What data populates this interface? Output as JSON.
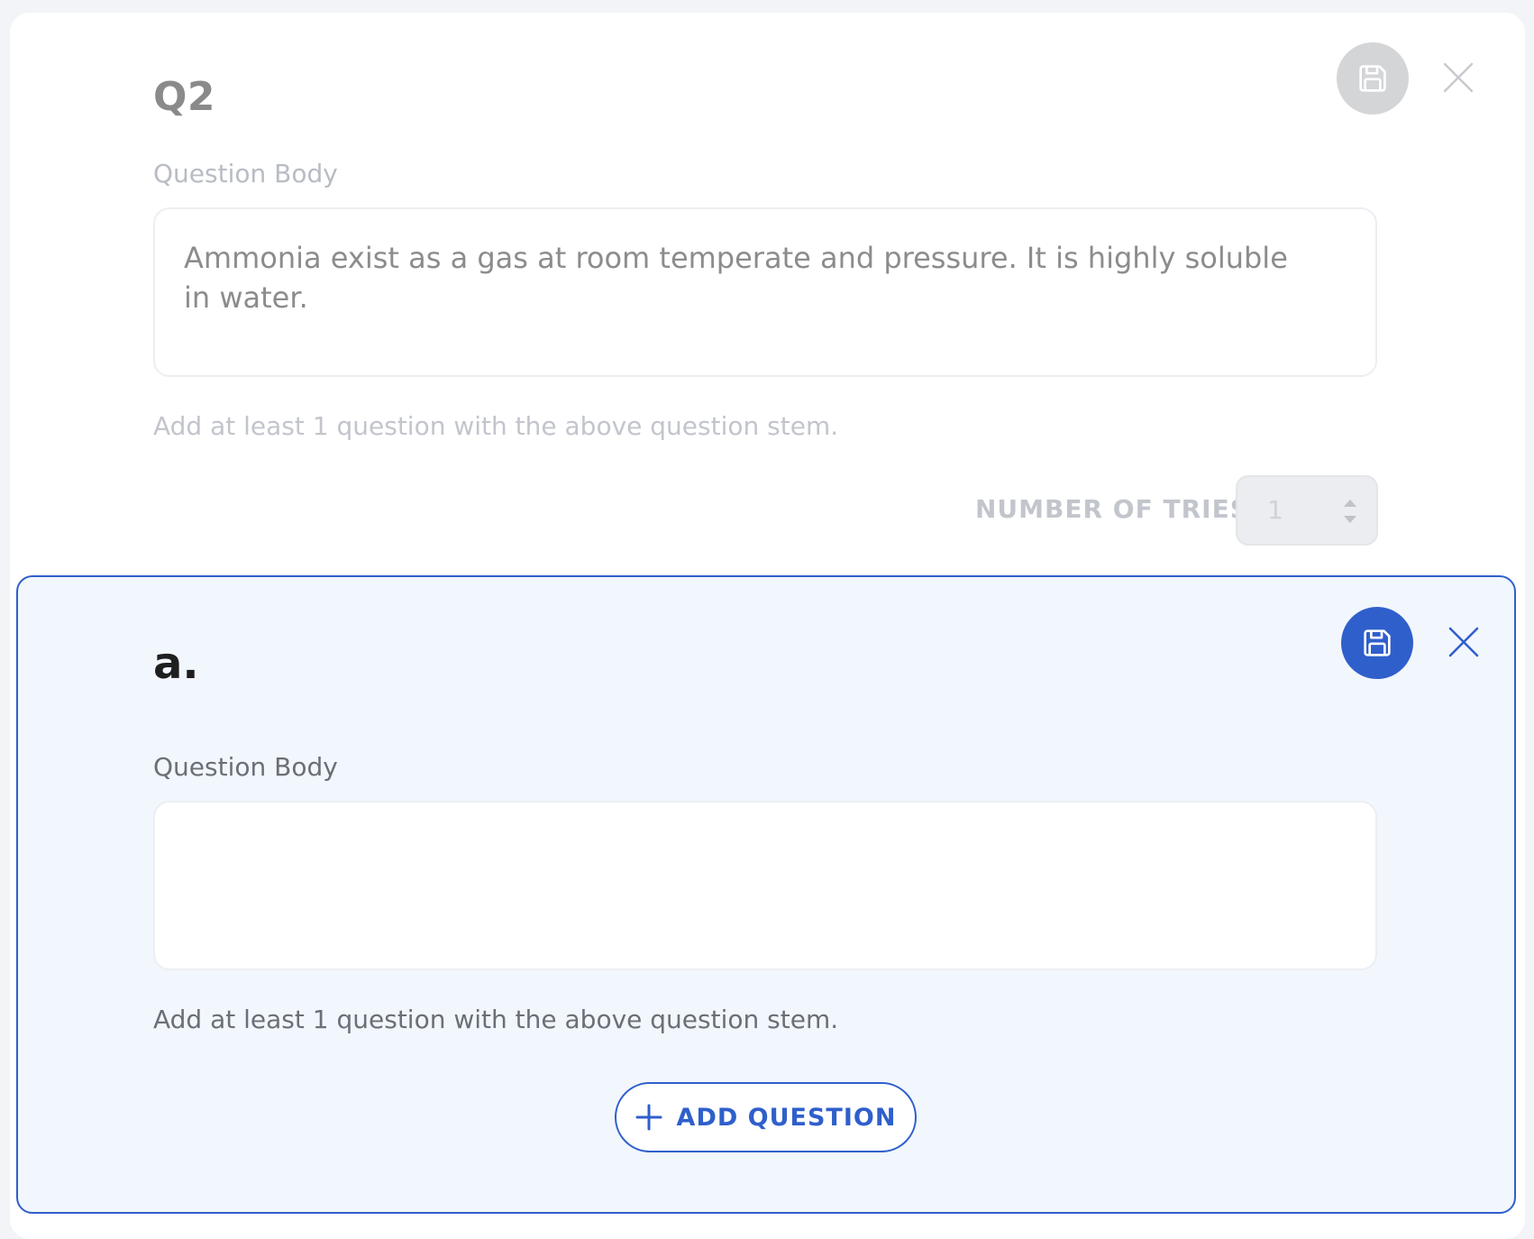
{
  "parent_question": {
    "title": "Q2",
    "body_label": "Question Body",
    "body_text": "Ammonia exist as a gas at room temperate and pressure. It is highly soluble in water.",
    "hint": "Add at least 1 question with the above question stem.",
    "tries_label": "NUMBER OF TRIES",
    "tries_value": "1",
    "save_icon": "save-icon",
    "close_icon": "close-icon"
  },
  "sub_question": {
    "title": "a.",
    "body_label": "Question Body",
    "body_text": "",
    "hint": "Add at least 1 question with the above question stem.",
    "add_button_label": "ADD QUESTION",
    "save_icon": "save-icon",
    "close_icon": "close-icon"
  },
  "colors": {
    "accent": "#2f5fcb",
    "disabled": "#d4d5d7",
    "sub_panel_bg": "#f2f6fd"
  }
}
